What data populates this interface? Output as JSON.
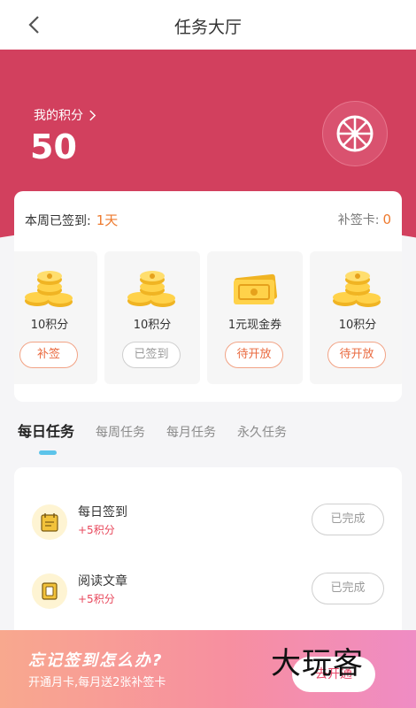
{
  "header": {
    "title": "任务大厅",
    "back_icon": "chevron-left-icon"
  },
  "points": {
    "label": "我的积分",
    "value": "50",
    "arrow_icon": "chevron-right-icon"
  },
  "lottery": {
    "icon": "wheel-icon",
    "label": "抽奖"
  },
  "week": {
    "signed_label": "本周已签到:",
    "signed_value": "1天",
    "card_label": "补签卡:",
    "card_value": "0"
  },
  "days": [
    {
      "icon": "coins-icon",
      "amount": "10积分",
      "status": "补签"
    },
    {
      "icon": "coins-icon",
      "amount": "10积分",
      "status": "已签到"
    },
    {
      "icon": "cash-voucher-icon",
      "amount": "1元现金券",
      "status": "待开放"
    },
    {
      "icon": "coins-icon",
      "amount": "10积分",
      "status": "待开放"
    }
  ],
  "tabs": [
    "每日任务",
    "每周任务",
    "每月任务",
    "永久任务"
  ],
  "tasks": [
    {
      "icon": "calendar-icon",
      "name": "每日签到",
      "reward": "+5积分",
      "status": "已完成"
    },
    {
      "icon": "article-icon",
      "name": "阅读文章",
      "reward": "+5积分",
      "status": "已完成"
    }
  ],
  "banner": {
    "title": "忘记签到怎么办?",
    "subtitle": "开通月卡,每月送2张补签卡",
    "button": "去开通"
  },
  "watermark": "大玩客",
  "colors": {
    "primary": "#d2405e",
    "accent_orange": "#ea6a3f",
    "tab_indicator": "#5dc4ea"
  }
}
